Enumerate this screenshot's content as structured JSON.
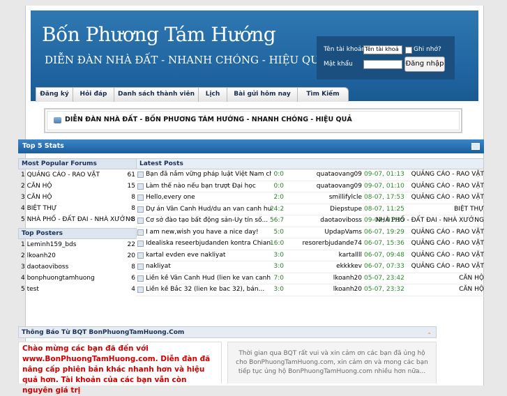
{
  "header": {
    "site_title": "Bốn Phương Tám Hướng",
    "slogan": "DIỄN ĐÀN NHÀ ĐẤT - NHANH CHÓNG - HIỆU QUẢ"
  },
  "login": {
    "username_label": "Tên tài khoản",
    "username_value": "Tên tài khoả",
    "remember_label": "Ghi nhớ?",
    "password_label": "Mật khẩu",
    "button_label": "Đăng nhập"
  },
  "nav": {
    "tabs": [
      "Đăng ký",
      "Hỏi đáp",
      "Danh sách thành viên",
      "Lịch",
      "Bài gửi hôm nay",
      "Tìm Kiếm"
    ]
  },
  "forum_title": "DIỄN ĐÀN NHÀ ĐẤT - BỐN PHƯƠNG TÁM HƯỚNG - NHANH CHÓNG - HIỆU QUẢ",
  "stats": {
    "title": "Top 5 Stats",
    "forums_header": "Most Popular Forums",
    "forums": [
      {
        "name": "1 QUẢNG CÁO - RAO VẶT",
        "count": "61"
      },
      {
        "name": "2 CĂN HỘ",
        "count": "15"
      },
      {
        "name": "3 CĂN HỘ",
        "count": "8"
      },
      {
        "name": "4 BIỆT THỰ",
        "count": "8"
      },
      {
        "name": "5 NHÀ PHỐ - ĐẤT ĐAI - NHÀ XƯỞNG",
        "count": "8"
      }
    ],
    "posters_header": "Top Posters",
    "posters": [
      {
        "name": "1 Leminh159_bds",
        "count": "22"
      },
      {
        "name": "2 lkoanh20",
        "count": "20"
      },
      {
        "name": "3 daotaoviboss",
        "count": "8"
      },
      {
        "name": "4 bonphuongtamhuong",
        "count": "6"
      },
      {
        "name": "5 test",
        "count": "4"
      }
    ],
    "latest_header": "Latest Posts",
    "posts": [
      {
        "title": "Bạn đã nắm vững pháp luật Việt Nam chưa...",
        "replies": "0",
        "views": "0",
        "user": "quataovang09",
        "date": "09-07, 01:13",
        "forum": "QUẢNG CÁO - RAO VẶT"
      },
      {
        "title": "Làm thế nào nếu bạn trượt Đại học",
        "replies": "0",
        "views": "0",
        "user": "quataovang09",
        "date": "09-07, 01:10",
        "forum": "QUẢNG CÁO - RAO VẶT"
      },
      {
        "title": "Hello,every one",
        "replies": "2",
        "views": "0",
        "user": "smillifylcle",
        "date": "08-07, 17:53",
        "forum": "QUẢNG CÁO - RAO VẶT"
      },
      {
        "title": "Dự án Vân Canh Hud/du an van canh hud,...",
        "replies": "24",
        "views": "2",
        "user": "Diepstupe",
        "date": "08-07, 11:25",
        "forum": "BIỆT THỰ"
      },
      {
        "title": "Cơ sở đào tạo bất động sản-Uy tín số...",
        "replies": "56",
        "views": "7",
        "user": "daotaoviboss",
        "date": "09-07, 01:15",
        "forum": "NHÀ PHỐ - ĐẤT ĐAI - NHÀ XƯỞNG"
      },
      {
        "title": "I am new,wish you have a nice day!",
        "replies": "5",
        "views": "0",
        "user": "UpdapVams",
        "date": "06-07, 19:29",
        "forum": "QUẢNG CÁO - RAO VẶT"
      },
      {
        "title": "Idealiska reseerbjudanden kontra Chiang...",
        "replies": "16",
        "views": "0",
        "user": "resorerbjudande74",
        "date": "06-07, 15:36",
        "forum": "QUẢNG CÁO - RAO VẶT"
      },
      {
        "title": "kartal evden eve nakliyat",
        "replies": "3",
        "views": "0",
        "user": "kartallll",
        "date": "06-07, 09:48",
        "forum": "QUẢNG CÁO - RAO VẶT"
      },
      {
        "title": "nakliyat",
        "replies": "3",
        "views": "0",
        "user": "ekkkkev",
        "date": "06-07, 07:33",
        "forum": "QUẢNG CÁO - RAO VẶT"
      },
      {
        "title": "Liền kề Vân Canh Hud (lien ke van canh...",
        "replies": "7",
        "views": "0",
        "user": "lkoanh20",
        "date": "05-07, 23:42",
        "forum": "CĂN HỘ"
      },
      {
        "title": "Liền kề Bắc 32 (lien ke bac 32), bán...",
        "replies": "3",
        "views": "0",
        "user": "lkoanh20",
        "date": "05-07, 23:32",
        "forum": "CĂN HỘ"
      }
    ]
  },
  "notice": {
    "title": "Thông Báo Từ BQT BonPhuongTamHuong.Com",
    "left_text": "Chào mừng các bạn đã đến với www.BonPhuongTamHuong.com. Diễn đàn đã nâng cấp phiên bản khác nhanh hơn và hiệu quả hơn. Tài khoản của các bạn vẫn còn nguyên giá trị",
    "right_text": "Thời gian qua BQT rất vui và xin cảm ơn các bạn đã ủng hộ cho BonPhuongTamHuong.com, xin cảm ơn và mong các bạn tiếp tục ủng hộ BonPhuongTamHuong.com nhiều hơn nữa..."
  },
  "colors": {
    "header_blue": "#1f64a0",
    "stats_bar": "#1b5e9d",
    "notice_red": "#d00000",
    "count_green": "#2a8a2a"
  },
  "icons": [
    "forum-icon",
    "post-icon",
    "collapse-icon",
    "expand-icon"
  ]
}
